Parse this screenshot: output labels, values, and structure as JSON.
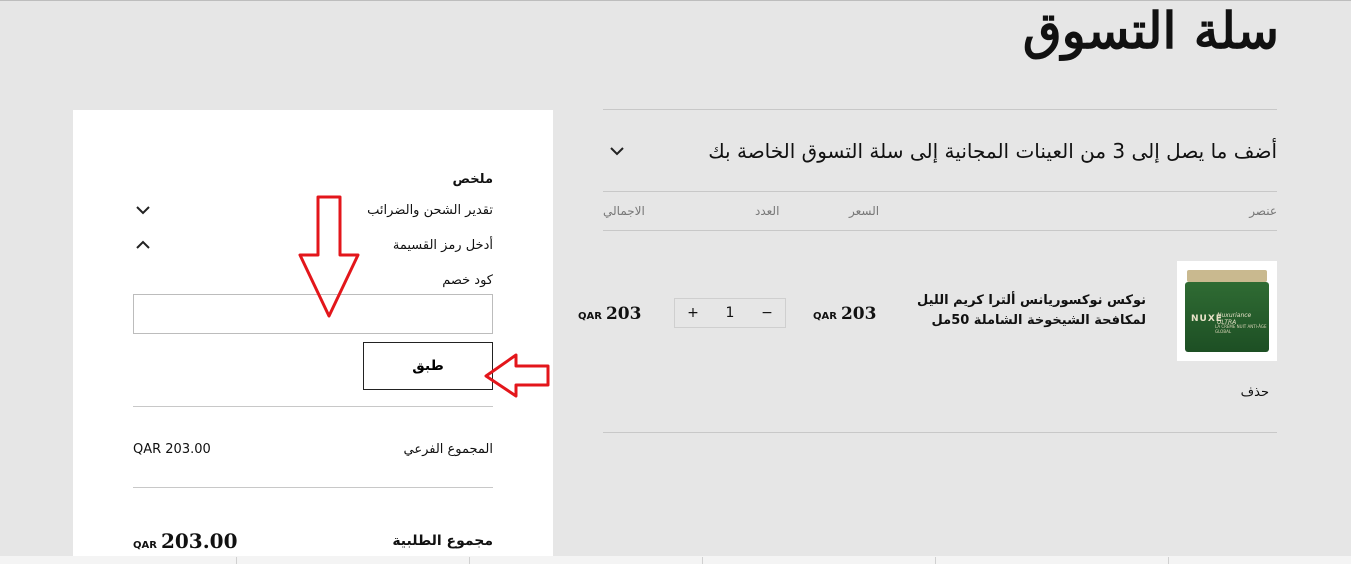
{
  "page": {
    "title": "سلة التسوق"
  },
  "cart": {
    "samples_text": "أضف ما يصل إلى 3 من العينات المجانية إلى سلة التسوق الخاصة بك",
    "columns": {
      "item": "عنصر",
      "price": "السعر",
      "quantity": "العدد",
      "total": "الاجمالي"
    },
    "item": {
      "name": "نوكس نوكسوريانس ألترا كريم الليل لمكافحة الشيخوخة الشاملة 50مل",
      "image_brand": "NUXE",
      "image_line": "Nuxuriance ULTRA",
      "image_caption": "LA CRÈME NUIT ANTI-ÂGE GLOBAL",
      "price_value": "203",
      "price_currency": "QAR",
      "quantity": "1",
      "minus": "−",
      "plus": "+",
      "total_value": "203",
      "total_currency": "QAR",
      "remove_label": "حذف"
    }
  },
  "summary": {
    "heading": "ملخص",
    "shipping_label": "تقدير الشحن والضرائب",
    "coupon_label": "أدخل رمز القسيمة",
    "discount_label": "كود خصم",
    "discount_value": "",
    "discount_placeholder": "",
    "apply_label": "طبق",
    "subtotal_label": "المجموع الفرعي",
    "subtotal_value": "QAR 203.00",
    "order_total_label": "مجموع الطلبية",
    "order_total_value": "203.00",
    "order_total_currency": "QAR"
  },
  "colors": {
    "page_bg": "#e6e6e6",
    "panel_bg": "#ffffff",
    "annotation_arrow": "#e3161b"
  }
}
